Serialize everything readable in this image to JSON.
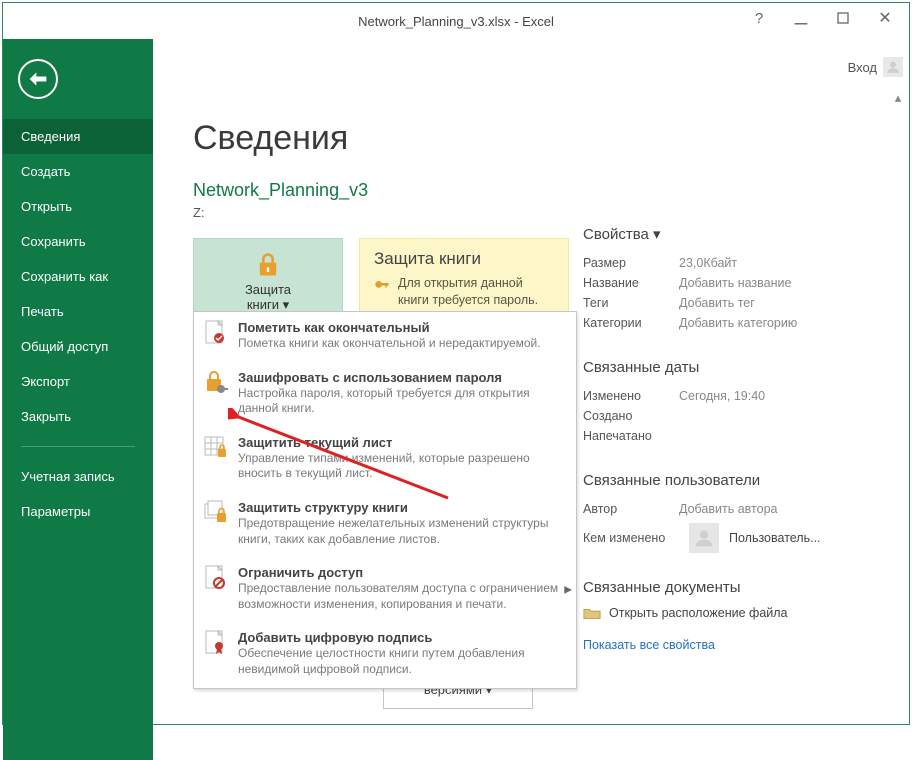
{
  "window": {
    "title": "Network_Planning_v3.xlsx - Excel"
  },
  "login": {
    "label": "Вход"
  },
  "sidebar": {
    "items": [
      {
        "label": "Сведения",
        "active": true
      },
      {
        "label": "Создать"
      },
      {
        "label": "Открыть"
      },
      {
        "label": "Сохранить"
      },
      {
        "label": "Сохранить как"
      },
      {
        "label": "Печать"
      },
      {
        "label": "Общий доступ"
      },
      {
        "label": "Экспорт"
      },
      {
        "label": "Закрыть"
      }
    ],
    "items2": [
      {
        "label": "Учетная запись"
      },
      {
        "label": "Параметры"
      }
    ]
  },
  "page": {
    "heading": "Сведения",
    "filename": "Network_Planning_v3",
    "path": "Z:"
  },
  "protect": {
    "button_label_line1": "Защита",
    "button_label_line2": "книги ▾",
    "panel_title": "Защита книги",
    "panel_text": "Для открытия данной книги требуется пароль."
  },
  "protect_menu": [
    {
      "title": "Пометить как окончательный",
      "desc": "Пометка книги как окончательной и нередактируемой."
    },
    {
      "title": "Зашифровать с использованием пароля",
      "desc": "Настройка пароля, который требуется для открытия данной книги."
    },
    {
      "title": "Защитить текущий лист",
      "desc": "Управление типами изменений, которые разрешено вносить в текущий лист."
    },
    {
      "title": "Защитить структуру книги",
      "desc": "Предотвращение нежелательных изменений структуры книги, таких как добавление листов."
    },
    {
      "title": "Ограничить доступ",
      "desc": "Предоставление пользователям доступа с ограничением возможности изменения, копирования и печати.",
      "has_sub": true
    },
    {
      "title": "Добавить цифровую подпись",
      "desc": "Обеспечение целостности книги путем добавления невидимой цифровой подписи."
    }
  ],
  "below_cap": "версиями ▾",
  "properties": {
    "header": "Свойства ▾",
    "rows": [
      {
        "label": "Размер",
        "value": "23,0Кбайт"
      },
      {
        "label": "Название",
        "value": "Добавить название"
      },
      {
        "label": "Теги",
        "value": "Добавить тег"
      },
      {
        "label": "Категории",
        "value": "Добавить категорию"
      }
    ],
    "dates_header": "Связанные даты",
    "dates": [
      {
        "label": "Изменено",
        "value": "Сегодня, 19:40"
      },
      {
        "label": "Создано",
        "value": ""
      },
      {
        "label": "Напечатано",
        "value": ""
      }
    ],
    "users_header": "Связанные пользователи",
    "users": [
      {
        "label": "Автор",
        "value": "Добавить автора"
      },
      {
        "label": "Кем изменено",
        "value": "Пользователь..."
      }
    ],
    "docs_header": "Связанные документы",
    "open_location": "Открыть расположение файла",
    "show_all": "Показать все свойства"
  }
}
